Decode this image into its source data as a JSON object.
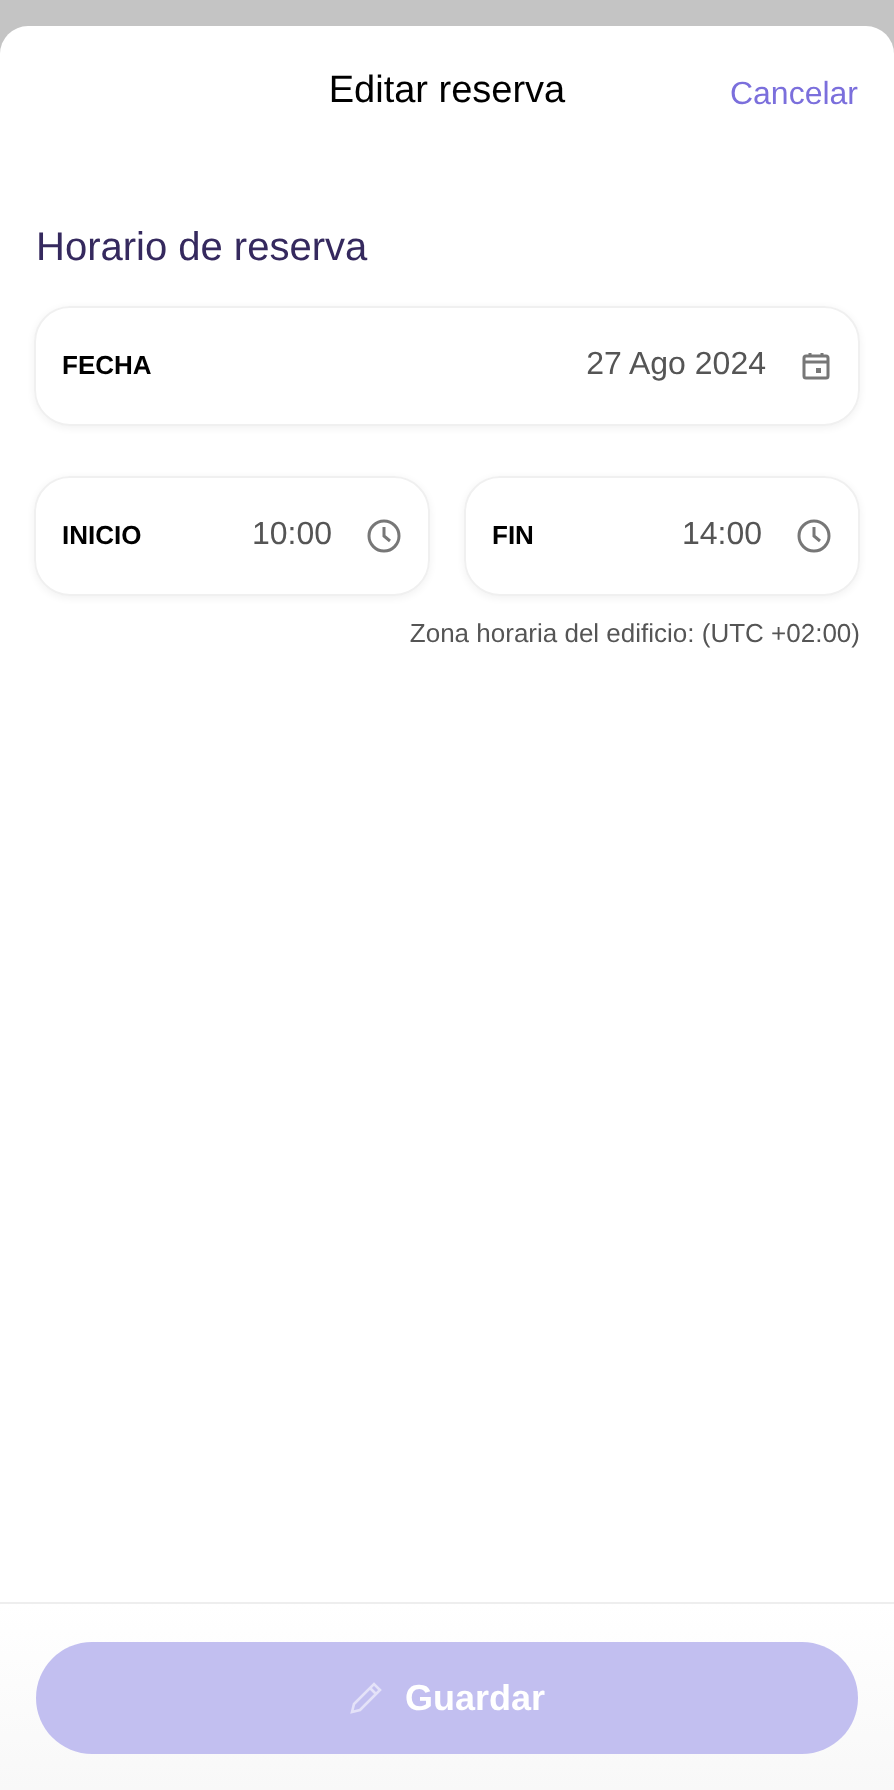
{
  "header": {
    "title": "Editar reserva",
    "cancel": "Cancelar"
  },
  "section_title": "Horario de reserva",
  "date_field": {
    "label": "FECHA",
    "value": "27 Ago 2024"
  },
  "time_fields": [
    {
      "label": "INICIO",
      "value": "10:00"
    },
    {
      "label": "FIN",
      "value": "14:00"
    }
  ],
  "timezone_note": "Zona horaria del edificio: (UTC +02:00)",
  "save_button": {
    "label": "Guardar",
    "disabled": true
  }
}
